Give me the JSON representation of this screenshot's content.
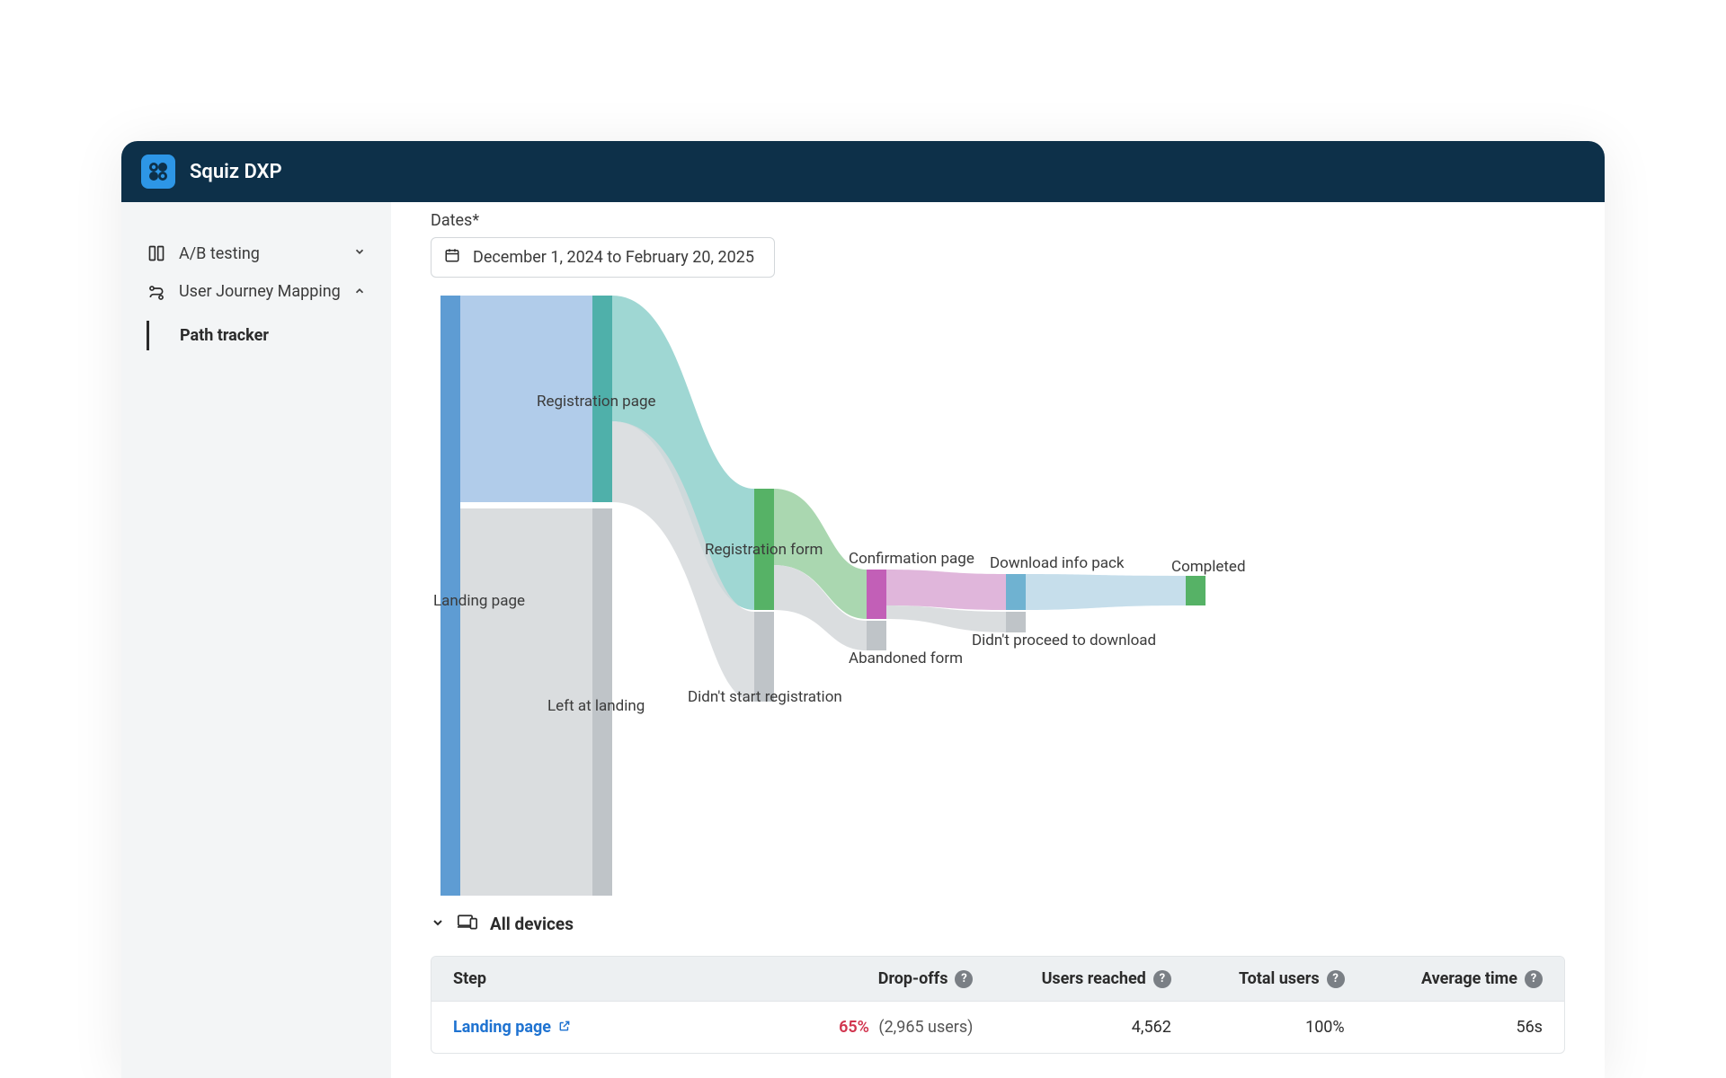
{
  "app": {
    "title": "Squiz DXP"
  },
  "sidebar": {
    "items": [
      {
        "label": "A/B testing",
        "icon": "compare-icon",
        "expanded": false
      },
      {
        "label": "User Journey Mapping",
        "icon": "route-icon",
        "expanded": true
      }
    ],
    "sub": {
      "label": "Path tracker"
    }
  },
  "dates": {
    "label": "Dates*",
    "value": "December 1, 2024 to February 20, 2025"
  },
  "chart_data": {
    "type": "sankey",
    "nodes": [
      {
        "id": "landing",
        "label": "Landing page"
      },
      {
        "id": "left_landing",
        "label": "Left at landing"
      },
      {
        "id": "registration_page",
        "label": "Registration page"
      },
      {
        "id": "no_start_reg",
        "label": "Didn't start registration"
      },
      {
        "id": "registration_form",
        "label": "Registration form"
      },
      {
        "id": "abandoned_form",
        "label": "Abandoned form"
      },
      {
        "id": "confirmation",
        "label": "Confirmation page"
      },
      {
        "id": "no_download",
        "label": "Didn't proceed to download"
      },
      {
        "id": "download",
        "label": "Download info pack"
      },
      {
        "id": "completed",
        "label": "Completed"
      }
    ],
    "links": [
      {
        "source": "landing",
        "target": "registration_page",
        "value": 1597
      },
      {
        "source": "landing",
        "target": "left_landing",
        "value": 2965
      },
      {
        "source": "registration_page",
        "target": "registration_form",
        "value": 912
      },
      {
        "source": "registration_page",
        "target": "no_start_reg",
        "value": 685
      },
      {
        "source": "registration_form",
        "target": "confirmation",
        "value": 593
      },
      {
        "source": "registration_form",
        "target": "abandoned_form",
        "value": 319
      },
      {
        "source": "confirmation",
        "target": "download",
        "value": 415
      },
      {
        "source": "confirmation",
        "target": "no_download",
        "value": 178
      },
      {
        "source": "download",
        "target": "completed",
        "value": 415
      }
    ],
    "total_users": 4562
  },
  "devices": {
    "label": "All devices"
  },
  "table": {
    "headers": {
      "step": "Step",
      "dropoffs": "Drop-offs",
      "users_reached": "Users reached",
      "total_users": "Total users",
      "avg_time": "Average time"
    },
    "rows": [
      {
        "step": "Landing page",
        "dropoffs_pct": "65%",
        "dropoffs_count": "(2,965 users)",
        "users_reached": "4,562",
        "total_users": "100%",
        "avg_time": "56s"
      }
    ]
  }
}
